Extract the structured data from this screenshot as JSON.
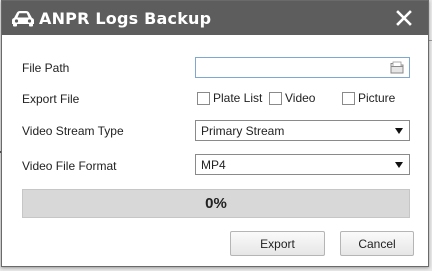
{
  "dialog": {
    "title": "ANPR Logs Backup",
    "title_icon": "car-icon",
    "close_icon": "close-icon"
  },
  "form": {
    "file_path": {
      "label": "File Path",
      "value": "",
      "icon": "folder-icon"
    },
    "export_file": {
      "label": "Export File",
      "options": [
        {
          "label": "Plate List",
          "checked": false
        },
        {
          "label": "Video",
          "checked": false
        },
        {
          "label": "Picture",
          "checked": false
        }
      ]
    },
    "video_stream_type": {
      "label": "Video Stream Type",
      "selected": "Primary Stream"
    },
    "video_file_format": {
      "label": "Video File Format",
      "selected": "MP4"
    }
  },
  "progress": {
    "value": 0,
    "text": "0%"
  },
  "buttons": {
    "export": "Export",
    "cancel": "Cancel"
  },
  "colors": {
    "titlebar": "#5d5d5d",
    "progress_track": "#d8d8d8",
    "field_focus_border": "#7fa7cf"
  }
}
